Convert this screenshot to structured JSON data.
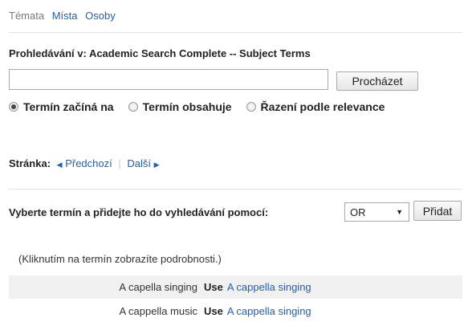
{
  "tabs": [
    {
      "label": "Témata",
      "active": true
    },
    {
      "label": "Místa",
      "active": false
    },
    {
      "label": "Osoby",
      "active": false
    }
  ],
  "search": {
    "title": "Prohledávání v: Academic Search Complete -- Subject Terms",
    "input_value": "",
    "browse_label": "Procházet"
  },
  "radio_options": [
    {
      "label": "Termín začíná na",
      "checked": true
    },
    {
      "label": "Termín obsahuje",
      "checked": false
    },
    {
      "label": "Řazení podle relevance",
      "checked": false
    }
  ],
  "pager": {
    "label": "Stránka:",
    "prev_label": "Předchozí",
    "next_label": "Další"
  },
  "add_to_search": {
    "label": "Vyberte termín a přidejte ho do vyhledávání pomocí:",
    "operator": "OR",
    "add_label": "Přidat"
  },
  "hint": "(Kliknutím na termín zobrazíte podrobnosti.)",
  "terms": [
    {
      "term": "A capella singing",
      "use_word": "Use",
      "use_link": "A cappella singing"
    },
    {
      "term": "A cappella music",
      "use_word": "Use",
      "use_link": "A cappella singing"
    }
  ]
}
